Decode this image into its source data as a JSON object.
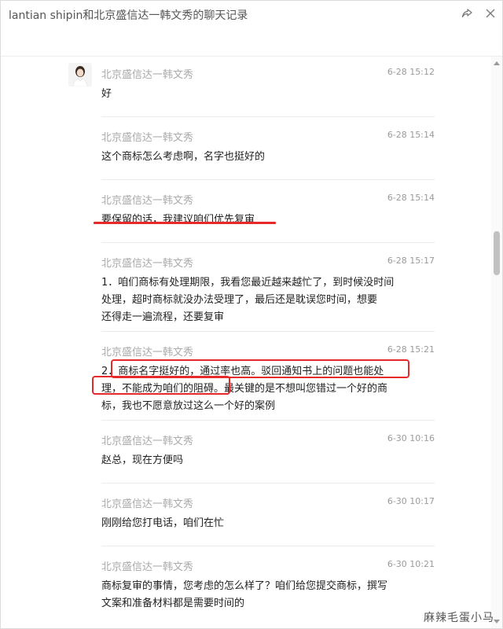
{
  "window": {
    "title": "lantian shipin和北京盛信达一韩文秀的聊天记录",
    "share_icon": "share-icon",
    "close_icon": "close-icon"
  },
  "messages": [
    {
      "sender": "北京盛信达一韩文秀",
      "time": "6-28 15:12",
      "text": "好"
    },
    {
      "sender": "北京盛信达一韩文秀",
      "time": "6-28 15:14",
      "text": "这个商标怎么考虑啊，名字也挺好的"
    },
    {
      "sender": "北京盛信达一韩文秀",
      "time": "6-28 15:14",
      "text": "要保留的话，我建议咱们优先复审"
    },
    {
      "sender": "北京盛信达一韩文秀",
      "time": "6-28 15:17",
      "text": "1．咱们商标有处理期限，我看您最近越来越忙了，到时候没时间\n处理，超时商标就没办法受理了，最后还是耽误您时间，想要\n还得走一遍流程，还要复审"
    },
    {
      "sender": "北京盛信达一韩文秀",
      "time": "6-28 15:21",
      "text": "2．商标名字挺好的，通过率也高。驳回通知书上的问题也能处\n理，不能成为咱们的阻碍。最关键的是不想叫您错过一个好的商\n标，我也不愿意放过这么一个好的案例"
    },
    {
      "sender": "北京盛信达一韩文秀",
      "time": "6-30 10:16",
      "text": "赵总，现在方便吗"
    },
    {
      "sender": "北京盛信达一韩文秀",
      "time": "6-30 10:17",
      "text": "刚刚给您打电话，咱们在忙"
    },
    {
      "sender": "北京盛信达一韩文秀",
      "time": "6-30 10:21",
      "text": "商标复审的事情，您考虑的怎么样了？咱们给您提交商标，撰写\n文案和准备材料都是需要时间的"
    }
  ],
  "watermark": "麻辣毛蛋小马",
  "colors": {
    "highlight": "#e8292b",
    "sender": "#a9a9a9"
  }
}
